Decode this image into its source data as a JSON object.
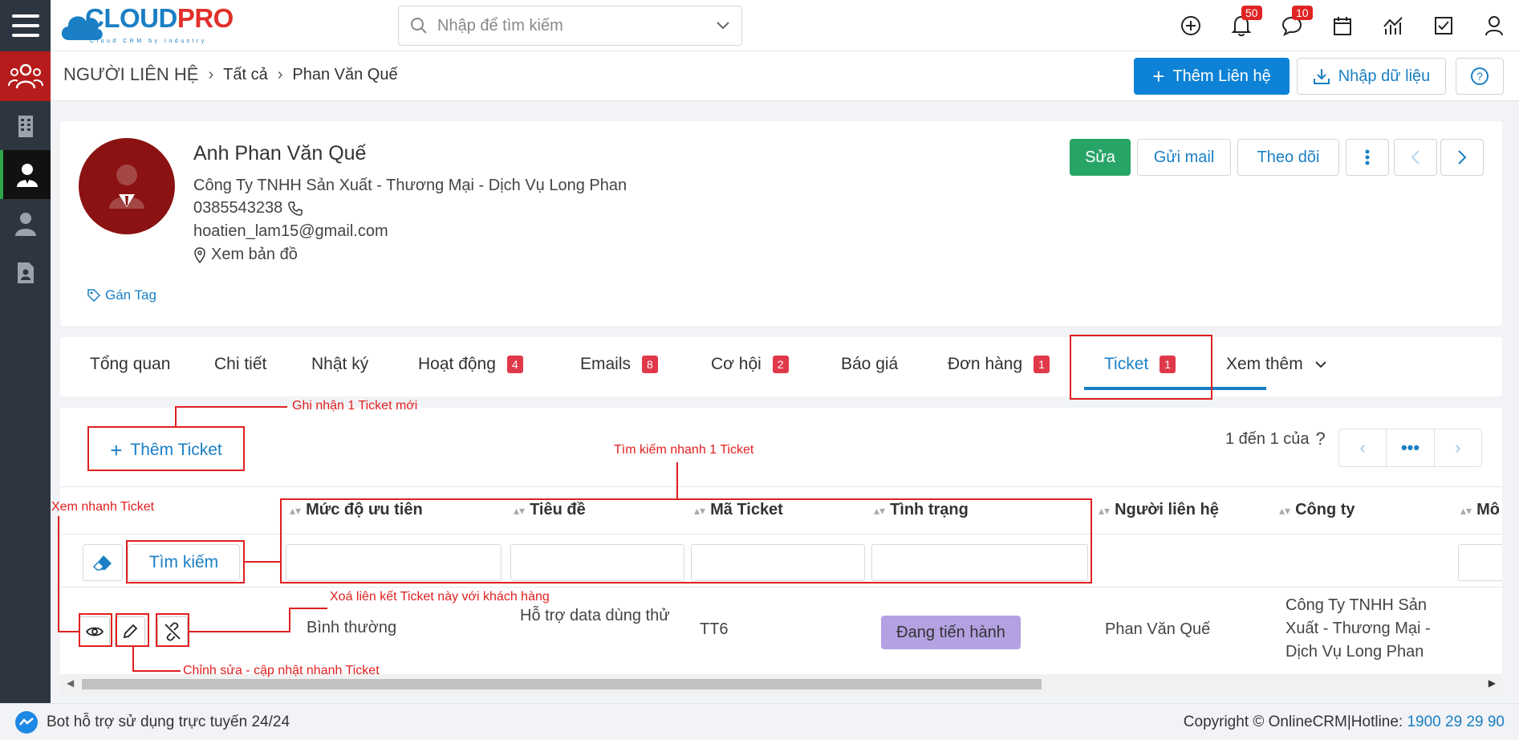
{
  "brand": {
    "logo_main": "CLOUD",
    "logo_accent": "PRO",
    "logo_sub": "Cloud CRM by Industry"
  },
  "search": {
    "placeholder": "Nhập để tìm kiếm"
  },
  "header": {
    "notifications_count": "50",
    "messages_count": "10"
  },
  "breadcrumb": {
    "root": "NGƯỜI LIÊN HỆ",
    "level1": "Tất cả",
    "level2": "Phan Văn Quế"
  },
  "actions": {
    "add_contact": "Thêm Liên hệ",
    "import": "Nhập dữ liệu"
  },
  "profile": {
    "name": "Anh Phan Văn Quế",
    "company": "Công Ty TNHH Sản Xuất - Thương Mại - Dịch Vụ Long Phan",
    "phone": "0385543238",
    "email": "hoatien_lam15@gmail.com",
    "map": "Xem bản đồ",
    "tag": "Gán Tag",
    "edit": "Sửa",
    "send_mail": "Gửi mail",
    "follow": "Theo dõi"
  },
  "tabs": [
    {
      "label": "Tổng quan"
    },
    {
      "label": "Chi tiết"
    },
    {
      "label": "Nhật ký"
    },
    {
      "label": "Hoạt động",
      "count": "4"
    },
    {
      "label": "Emails",
      "count": "8"
    },
    {
      "label": "Cơ hội",
      "count": "2"
    },
    {
      "label": "Báo giá"
    },
    {
      "label": "Đơn hàng",
      "count": "1"
    },
    {
      "label": "Ticket",
      "count": "1"
    },
    {
      "label": "Xem thêm"
    }
  ],
  "ticket_panel": {
    "add_ticket": "Thêm Ticket",
    "pager_text": "1 đến 1 của",
    "pager_help": "?",
    "search_button": "Tìm kiếm",
    "columns": [
      "Mức độ ưu tiên",
      "Tiêu đề",
      "Mã Ticket",
      "Tình trạng",
      "Người liên hệ",
      "Công ty",
      "Mô"
    ],
    "rows": [
      {
        "priority": "Bình thường",
        "title": "Hỗ trợ data dùng thử",
        "code": "TT6",
        "status": "Đang tiến hành",
        "contact": "Phan Văn Quế",
        "company": "Công Ty TNHH Sản Xuất - Thương Mại - Dịch Vụ Long Phan"
      }
    ]
  },
  "annotations": {
    "add_new": "Ghi nhận 1 Ticket mới",
    "quick_search": "Tìm kiếm nhanh 1 Ticket",
    "quick_view": "Xem nhanh Ticket",
    "unlink": "Xoá liên kết Ticket này với khách hàng",
    "quick_edit": "Chỉnh sửa - cập nhật nhanh Ticket"
  },
  "footer": {
    "bot": "Bot hỗ trợ sử dụng trực tuyến 24/24",
    "copyright": "Copyright © OnlineCRM|Hotline:",
    "hotline": "1900 29 29 90"
  },
  "colors": {
    "primary": "#0d82d6",
    "sidebar": "#2d3540",
    "accent_red": "#b71c1c",
    "success": "#27a567",
    "status_purple": "#b4a1e2",
    "annotation": "#e02020"
  },
  "icons": [
    "hamburger-icon",
    "search-icon",
    "plus-circle-icon",
    "bell-icon",
    "chat-icon",
    "calendar-icon",
    "chart-icon",
    "checkbox-icon",
    "user-icon",
    "contacts-icon",
    "building-icon",
    "eye-icon",
    "pencil-icon",
    "unlink-icon",
    "eraser-icon",
    "messenger-icon"
  ]
}
